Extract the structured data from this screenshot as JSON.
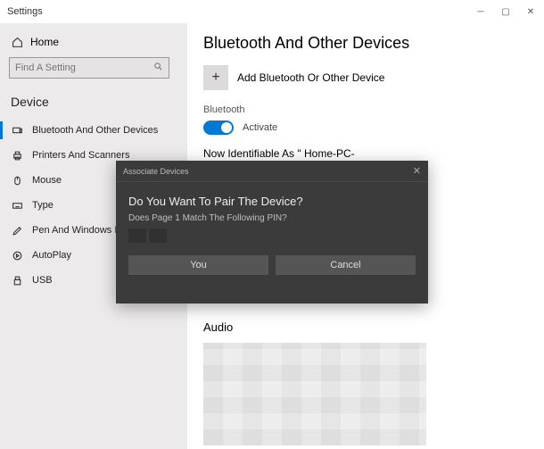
{
  "titlebar": {
    "title": "Settings"
  },
  "sidebar": {
    "home": "Home",
    "search_placeholder": "Find A Setting",
    "section": "Device",
    "items": [
      {
        "label": "Bluetooth And Other Devices"
      },
      {
        "label": "Printers And Scanners"
      },
      {
        "label": "Mouse"
      },
      {
        "label": "Type"
      },
      {
        "label": "Pen And Windows Ink"
      },
      {
        "label": "AutoPlay"
      },
      {
        "label": "USB"
      }
    ]
  },
  "page": {
    "title": "Bluetooth And Other Devices",
    "add_label": "Add Bluetooth Or Other Device",
    "bluetooth_head": "Bluetooth",
    "toggle_label": "Activate",
    "status": "Now Identifiable As \" Home-PC-",
    "audio_head": "Audio"
  },
  "dialog": {
    "header": "Associate Devices",
    "title": "Do You Want To Pair The Device?",
    "sub": "Does Page 1 Match The Following PIN?",
    "yes": "You",
    "cancel": "Cancel"
  }
}
